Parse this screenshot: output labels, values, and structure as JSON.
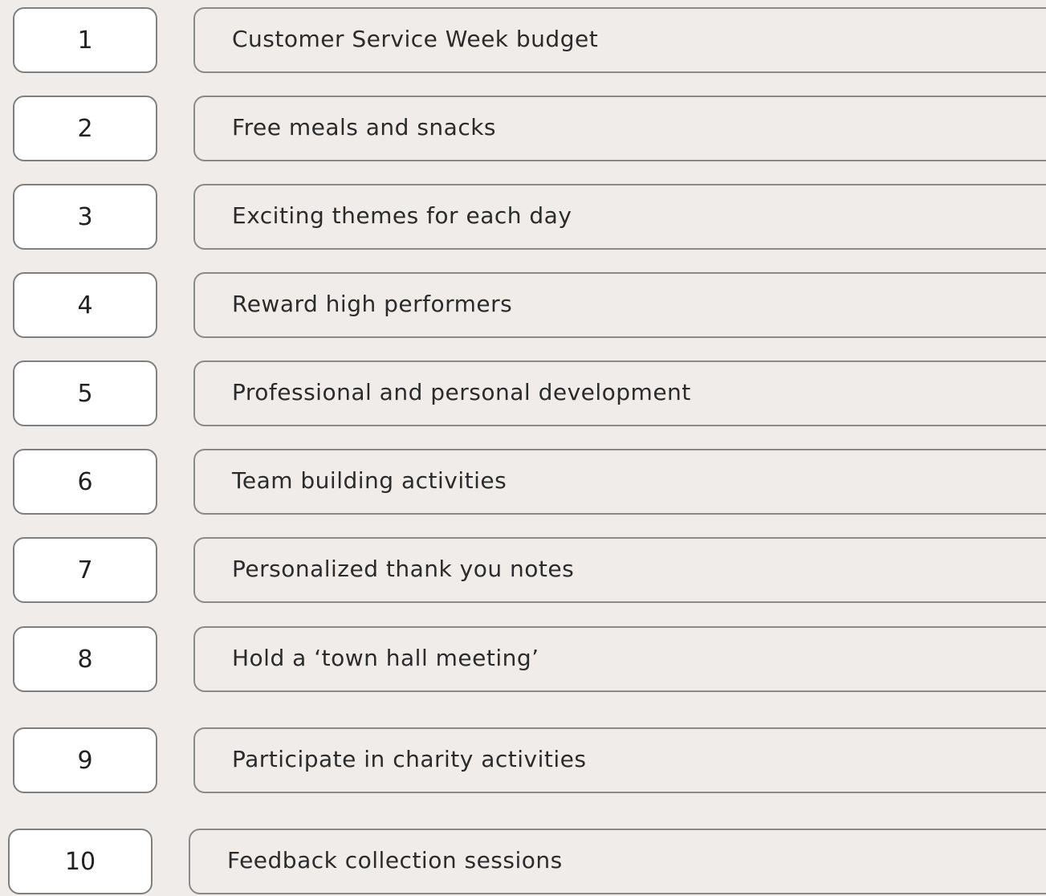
{
  "items": [
    {
      "number": "1",
      "label": "Customer Service Week budget"
    },
    {
      "number": "2",
      "label": "Free meals and snacks"
    },
    {
      "number": "3",
      "label": "Exciting themes for each day"
    },
    {
      "number": "4",
      "label": "Reward high performers"
    },
    {
      "number": "5",
      "label": "Professional and personal development"
    },
    {
      "number": "6",
      "label": "Team building activities"
    },
    {
      "number": "7",
      "label": "Personalized thank you notes"
    },
    {
      "number": "8",
      "label": "Hold a ‘town hall meeting’"
    },
    {
      "number": "9",
      "label": "Participate in charity activities"
    },
    {
      "number": "10",
      "label": "Feedback collection sessions"
    }
  ]
}
